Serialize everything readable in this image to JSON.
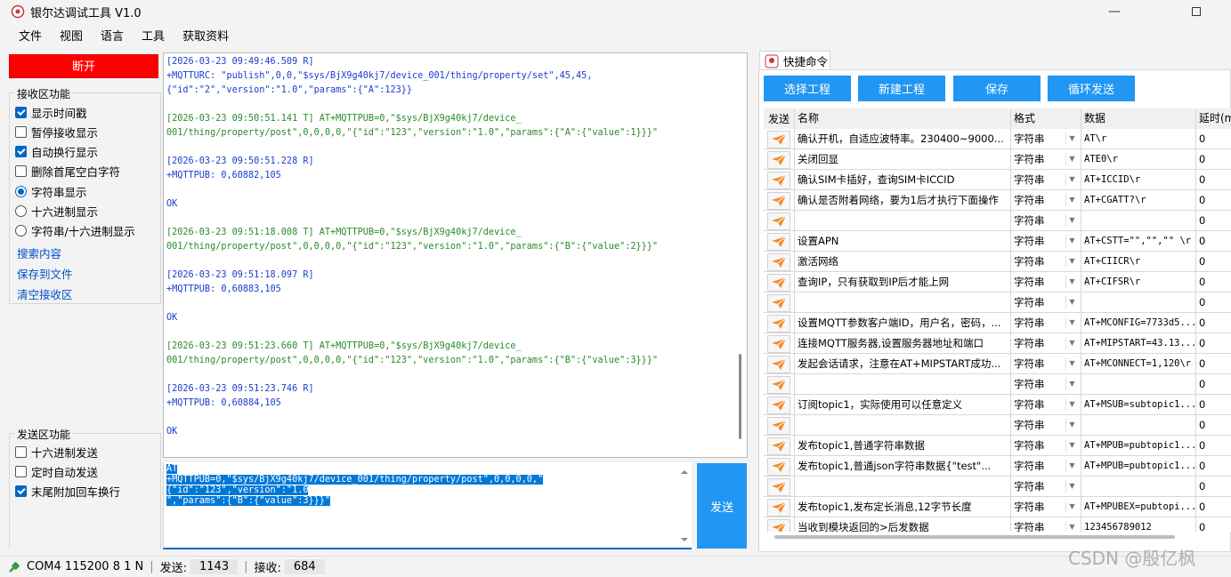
{
  "window": {
    "title": "银尔达调试工具 V1.0"
  },
  "menu": [
    "文件",
    "视图",
    "语言",
    "工具",
    "获取资料"
  ],
  "left": {
    "disconnect_label": "断开",
    "recv_group": {
      "title": "接收区功能",
      "options": [
        {
          "label": "显示时间戳",
          "type": "checkbox",
          "checked": true
        },
        {
          "label": "暂停接收显示",
          "type": "checkbox",
          "checked": false
        },
        {
          "label": "自动换行显示",
          "type": "checkbox",
          "checked": true
        },
        {
          "label": "删除首尾空白字符",
          "type": "checkbox",
          "checked": false
        },
        {
          "label": "字符串显示",
          "type": "radio",
          "checked": true
        },
        {
          "label": "十六进制显示",
          "type": "radio",
          "checked": false
        },
        {
          "label": "字符串/十六进制显示",
          "type": "radio",
          "checked": false
        }
      ],
      "links": [
        "搜索内容",
        "保存到文件",
        "清空接收区"
      ]
    },
    "send_group": {
      "title": "发送区功能",
      "options": [
        {
          "label": "十六进制发送",
          "checked": false
        },
        {
          "label": "定时自动发送",
          "checked": false
        },
        {
          "label": "末尾附加回车换行",
          "checked": true
        }
      ]
    }
  },
  "receive": {
    "lines": [
      {
        "text": "[2026-03-23 09:49:46.509 R]",
        "kind": "ts"
      },
      {
        "text": "+MQTTURC: \"publish\",0,0,\"$sys/BjX9g40kj7/device_001/thing/property/set\",45,45,",
        "kind": "rx"
      },
      {
        "text": "{\"id\":\"2\",\"version\":\"1.0\",\"params\":{\"A\":123}}",
        "kind": "rx"
      },
      {
        "text": "",
        "kind": "rx"
      },
      {
        "text": "[2026-03-23 09:50:51.141 T] AT+MQTTPUB=0,\"$sys/BjX9g40kj7/device_",
        "kind": "tx"
      },
      {
        "text": "001/thing/property/post\",0,0,0,0,\"{\"id\":\"123\",\"version\":\"1.0\",\"params\":{\"A\":{\"value\":1}}}\"",
        "kind": "tx"
      },
      {
        "text": "",
        "kind": "rx"
      },
      {
        "text": "[2026-03-23 09:50:51.228 R]",
        "kind": "ts"
      },
      {
        "text": "+MQTTPUB: 0,60882,105",
        "kind": "rx"
      },
      {
        "text": "",
        "kind": "rx"
      },
      {
        "text": "OK",
        "kind": "rx"
      },
      {
        "text": "",
        "kind": "rx"
      },
      {
        "text": "[2026-03-23 09:51:18.008 T] AT+MQTTPUB=0,\"$sys/BjX9g40kj7/device_",
        "kind": "tx"
      },
      {
        "text": "001/thing/property/post\",0,0,0,0,\"{\"id\":\"123\",\"version\":\"1.0\",\"params\":{\"B\":{\"value\":2}}}\"",
        "kind": "tx"
      },
      {
        "text": "",
        "kind": "rx"
      },
      {
        "text": "[2026-03-23 09:51:18.097 R]",
        "kind": "ts"
      },
      {
        "text": "+MQTTPUB: 0,60883,105",
        "kind": "rx"
      },
      {
        "text": "",
        "kind": "rx"
      },
      {
        "text": "OK",
        "kind": "rx"
      },
      {
        "text": "",
        "kind": "rx"
      },
      {
        "text": "[2026-03-23 09:51:23.660 T] AT+MQTTPUB=0,\"$sys/BjX9g40kj7/device_",
        "kind": "tx"
      },
      {
        "text": "001/thing/property/post\",0,0,0,0,\"{\"id\":\"123\",\"version\":\"1.0\",\"params\":{\"B\":{\"value\":3}}}\"",
        "kind": "tx"
      },
      {
        "text": "",
        "kind": "rx"
      },
      {
        "text": "[2026-03-23 09:51:23.746 R]",
        "kind": "ts"
      },
      {
        "text": "+MQTTPUB: 0,60884,105",
        "kind": "rx"
      },
      {
        "text": "",
        "kind": "rx"
      },
      {
        "text": "OK",
        "kind": "rx"
      }
    ]
  },
  "send": {
    "lines": [
      "AT",
      "+MQTTPUB=0,\"$sys/BjX9g40kj7/device_001/thing/property/post\",0,0,0,0,\"{\"id\":\"123\",\"version\":\"1.0",
      "\",\"params\":{\"B\":{\"value\":3}}}\""
    ],
    "send_label": "发送"
  },
  "quick": {
    "tab_label": "快捷命令",
    "buttons": [
      "选择工程",
      "新建工程",
      "保存",
      "循环发送"
    ],
    "columns": [
      "发送",
      "名称",
      "格式",
      "数据",
      "延时(m"
    ],
    "rows": [
      {
        "name": "确认开机，自适应波特率。230400~9000...",
        "format": "字符串",
        "data": "AT\\r",
        "delay": "0"
      },
      {
        "name": "关闭回显",
        "format": "字符串",
        "data": "ATE0\\r",
        "delay": "0"
      },
      {
        "name": "确认SIM卡插好，查询SIM卡ICCID",
        "format": "字符串",
        "data": "AT+ICCID\\r",
        "delay": "0"
      },
      {
        "name": "确认是否附着网络，要为1后才执行下面操作",
        "format": "字符串",
        "data": "AT+CGATT?\\r",
        "delay": "0"
      },
      {
        "name": "",
        "format": "字符串",
        "data": "",
        "delay": "0"
      },
      {
        "name": "设置APN",
        "format": "字符串",
        "data": "AT+CSTT=\"\",\"\",\"\" \\r",
        "delay": "0"
      },
      {
        "name": "激活网络",
        "format": "字符串",
        "data": "AT+CIICR\\r",
        "delay": "0"
      },
      {
        "name": "查询IP，只有获取到IP后才能上网",
        "format": "字符串",
        "data": "AT+CIFSR\\r",
        "delay": "0"
      },
      {
        "name": "",
        "format": "字符串",
        "data": "",
        "delay": "0"
      },
      {
        "name": "设置MQTT参数客户端ID，用户名，密码，...",
        "format": "字符串",
        "data": "AT+MCONFIG=7733d5...",
        "delay": "0"
      },
      {
        "name": "连接MQTT服务器,设置服务器地址和端口",
        "format": "字符串",
        "data": "AT+MIPSTART=43.13...",
        "delay": "0"
      },
      {
        "name": "发起会话请求，注意在AT+MIPSTART成功...",
        "format": "字符串",
        "data": "AT+MCONNECT=1,120\\r",
        "delay": "0"
      },
      {
        "name": "",
        "format": "字符串",
        "data": "",
        "delay": "0"
      },
      {
        "name": "订阅topic1，实际使用可以任意定义",
        "format": "字符串",
        "data": "AT+MSUB=subtopic1...",
        "delay": "0"
      },
      {
        "name": "",
        "format": "字符串",
        "data": "",
        "delay": "0"
      },
      {
        "name": "发布topic1,普通字符串数据",
        "format": "字符串",
        "data": "AT+MPUB=pubtopic1...",
        "delay": "0"
      },
      {
        "name": "发布topic1,普通json字符串数据{\"test\"...",
        "format": "字符串",
        "data": "AT+MPUB=pubtopic1...",
        "delay": "0"
      },
      {
        "name": "",
        "format": "字符串",
        "data": "",
        "delay": "0"
      },
      {
        "name": "发布topic1,发布定长消息,12字节长度",
        "format": "字符串",
        "data": "AT+MPUBEX=pubtopi...",
        "delay": "0"
      },
      {
        "name": "当收到模块返回的>后发数据",
        "format": "字符串",
        "data": "123456789012",
        "delay": "0"
      }
    ]
  },
  "status": {
    "port": "COM4 115200 8 1 N",
    "sent_label": "发送:",
    "sent_count": "1143",
    "recv_label": "接收:",
    "recv_count": "684"
  },
  "watermark": "CSDN @殷亿枫",
  "colors": {
    "disconnect": "#ff0000",
    "button_blue": "#2196f3",
    "accent": "#0067c0"
  }
}
